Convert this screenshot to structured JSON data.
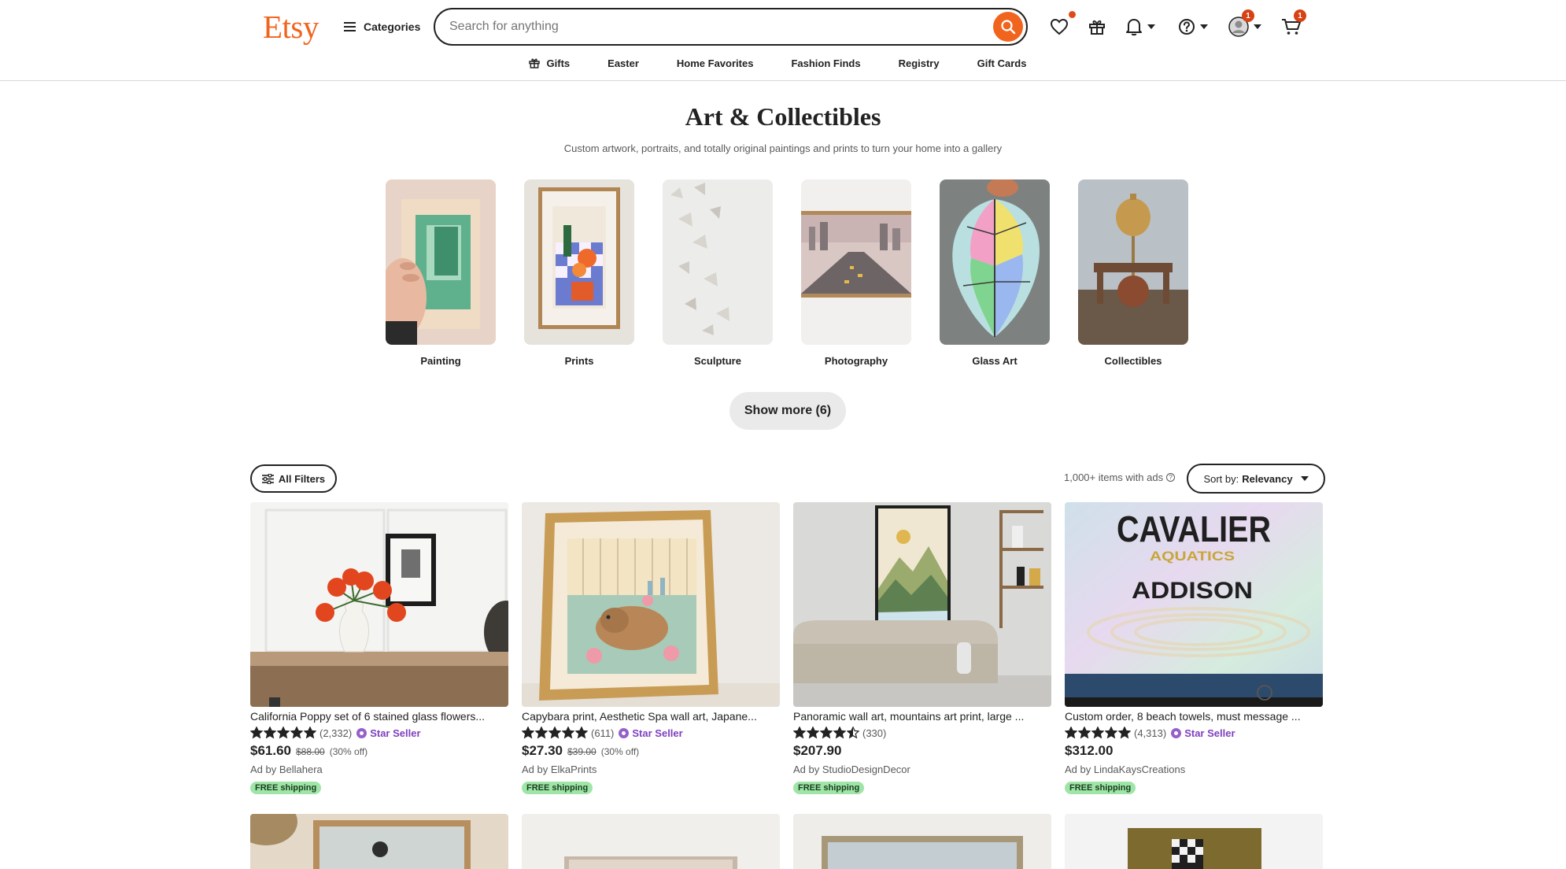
{
  "header": {
    "logo": "Etsy",
    "categories_label": "Categories",
    "search_placeholder": "Search for anything",
    "notifications_count": "1",
    "cart_count": "1"
  },
  "subnav": [
    {
      "label": "Gifts",
      "icon": "gift-icon"
    },
    {
      "label": "Easter"
    },
    {
      "label": "Home Favorites"
    },
    {
      "label": "Fashion Finds"
    },
    {
      "label": "Registry"
    },
    {
      "label": "Gift Cards"
    }
  ],
  "hero": {
    "title": "Art & Collectibles",
    "subtitle": "Custom artwork, portraits, and totally original paintings and prints to turn your home into a gallery"
  },
  "categories": [
    {
      "label": "Painting"
    },
    {
      "label": "Prints"
    },
    {
      "label": "Sculpture"
    },
    {
      "label": "Photography"
    },
    {
      "label": "Glass Art"
    },
    {
      "label": "Collectibles"
    }
  ],
  "show_more_label": "Show more (6)",
  "filters": {
    "all_filters_label": "All Filters",
    "results_count": "1,000+ items with ads",
    "sort_prefix": "Sort by:",
    "sort_value": "Relevancy"
  },
  "listings": [
    {
      "title": "California Poppy set of 6 stained glass flowers...",
      "rating": 5,
      "reviews": "(2,332)",
      "star_seller": "Star Seller",
      "price": "$61.60",
      "original_price": "$88.00",
      "discount": "(30% off)",
      "ad_by": "Ad by Bellahera",
      "free_shipping": "FREE shipping"
    },
    {
      "title": "Capybara print, Aesthetic Spa wall art, Japane...",
      "rating": 5,
      "reviews": "(611)",
      "star_seller": "Star Seller",
      "price": "$27.30",
      "original_price": "$39.00",
      "discount": "(30% off)",
      "ad_by": "Ad by ElkaPrints",
      "free_shipping": "FREE shipping"
    },
    {
      "title": "Panoramic wall art, mountains art print, large ...",
      "rating": 4.5,
      "reviews": "(330)",
      "price": "$207.90",
      "ad_by": "Ad by StudioDesignDecor",
      "free_shipping": "FREE shipping"
    },
    {
      "title": "Custom order, 8 beach towels, must message ...",
      "rating": 5,
      "reviews": "(4,313)",
      "star_seller": "Star Seller",
      "price": "$312.00",
      "ad_by": "Ad by LindaKaysCreations",
      "free_shipping": "FREE shipping",
      "image_text": {
        "line1": "CAVALIER",
        "line2": "AQUATICS",
        "line3": "ADDISON"
      }
    }
  ],
  "colors": {
    "brand": "#f1641e",
    "star_seller": "#7f3fbf",
    "free_shipping_bg": "#9ee5a7",
    "badge": "#d64214"
  }
}
